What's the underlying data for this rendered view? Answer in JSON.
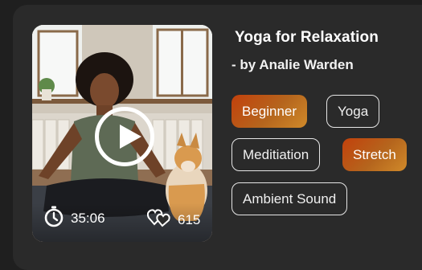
{
  "video": {
    "duration": "35:06",
    "likes": "615",
    "icons": {
      "play": "play-icon",
      "timer": "stopwatch-icon",
      "likes": "hearts-icon"
    }
  },
  "details": {
    "title": "Yoga for Relaxation",
    "subtitle": "- by Analie Warden"
  },
  "tags": [
    {
      "label": "Beginner",
      "active": true
    },
    {
      "label": "Yoga",
      "active": false
    },
    {
      "label": "Meditiation",
      "active": false
    },
    {
      "label": "Stretch",
      "active": true
    },
    {
      "label": "Ambient Sound",
      "active": false
    }
  ],
  "colors": {
    "background": "#1f1f1f",
    "card": "#2a2a2a",
    "accent_start": "#c2410c",
    "accent_end": "#d08a2a"
  }
}
